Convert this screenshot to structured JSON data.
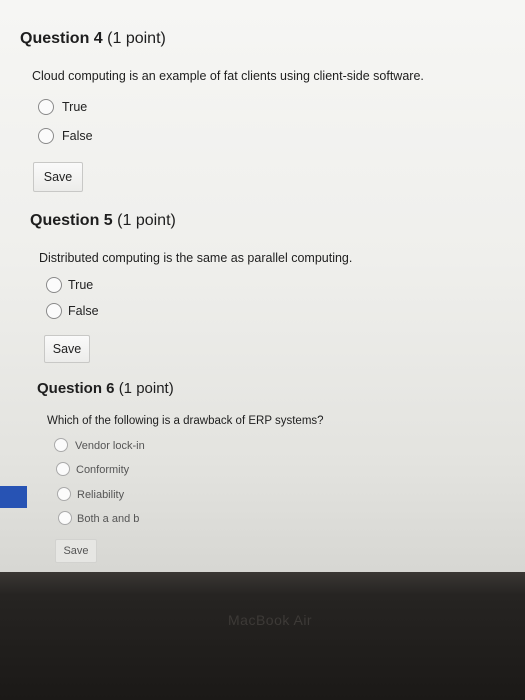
{
  "questions": [
    {
      "heading": "Question 4",
      "points": "(1 point)",
      "text": "Cloud computing is an example of fat clients using client-side software.",
      "options": [
        "True",
        "False"
      ],
      "save_label": "Save"
    },
    {
      "heading": "Question 5",
      "points": "(1 point)",
      "text": "Distributed computing is the same as parallel computing.",
      "options": [
        "True",
        "False"
      ],
      "save_label": "Save"
    },
    {
      "heading": "Question 6",
      "points": "(1 point)",
      "text": "Which of the following is a drawback of ERP systems?",
      "options": [
        "Vendor lock-in",
        "Conformity",
        "Reliability",
        "Both a and b"
      ],
      "save_label": "Save"
    }
  ],
  "device": {
    "brand": "MacBook Air"
  },
  "colors": {
    "accent_tab": "#2753b4"
  }
}
